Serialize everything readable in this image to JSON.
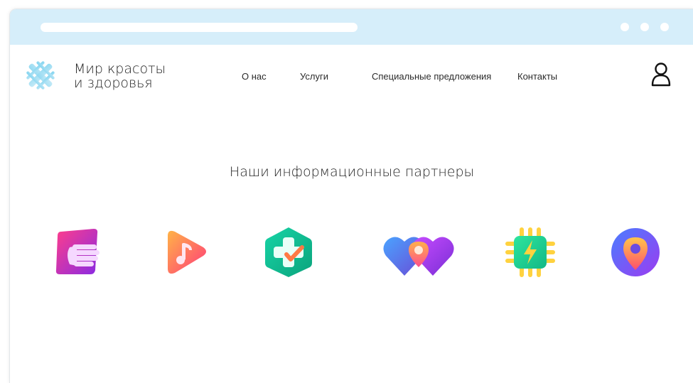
{
  "brand": {
    "line1": "Мир красоты",
    "line2": "и здоровья",
    "logo_icon": "woven-pattern-icon"
  },
  "nav": {
    "items": [
      {
        "label": "О нас"
      },
      {
        "label": "Услуги"
      },
      {
        "label": "Специальные предложения"
      },
      {
        "label": "Контакты"
      }
    ]
  },
  "user_icon": "user-icon",
  "partners": {
    "title": "Наши информационные партнеры",
    "logos": [
      {
        "icon": "hand-icon"
      },
      {
        "icon": "music-play-icon"
      },
      {
        "icon": "medical-cross-icon"
      },
      {
        "icon": "hearts-location-icon"
      },
      {
        "icon": "chip-lightning-icon"
      },
      {
        "icon": "map-pin-icon"
      }
    ]
  },
  "colors": {
    "browser_bar": "#d6eefa",
    "text": "#222222",
    "accent_pink": "#e8378a",
    "accent_purple": "#7b3fe4"
  }
}
